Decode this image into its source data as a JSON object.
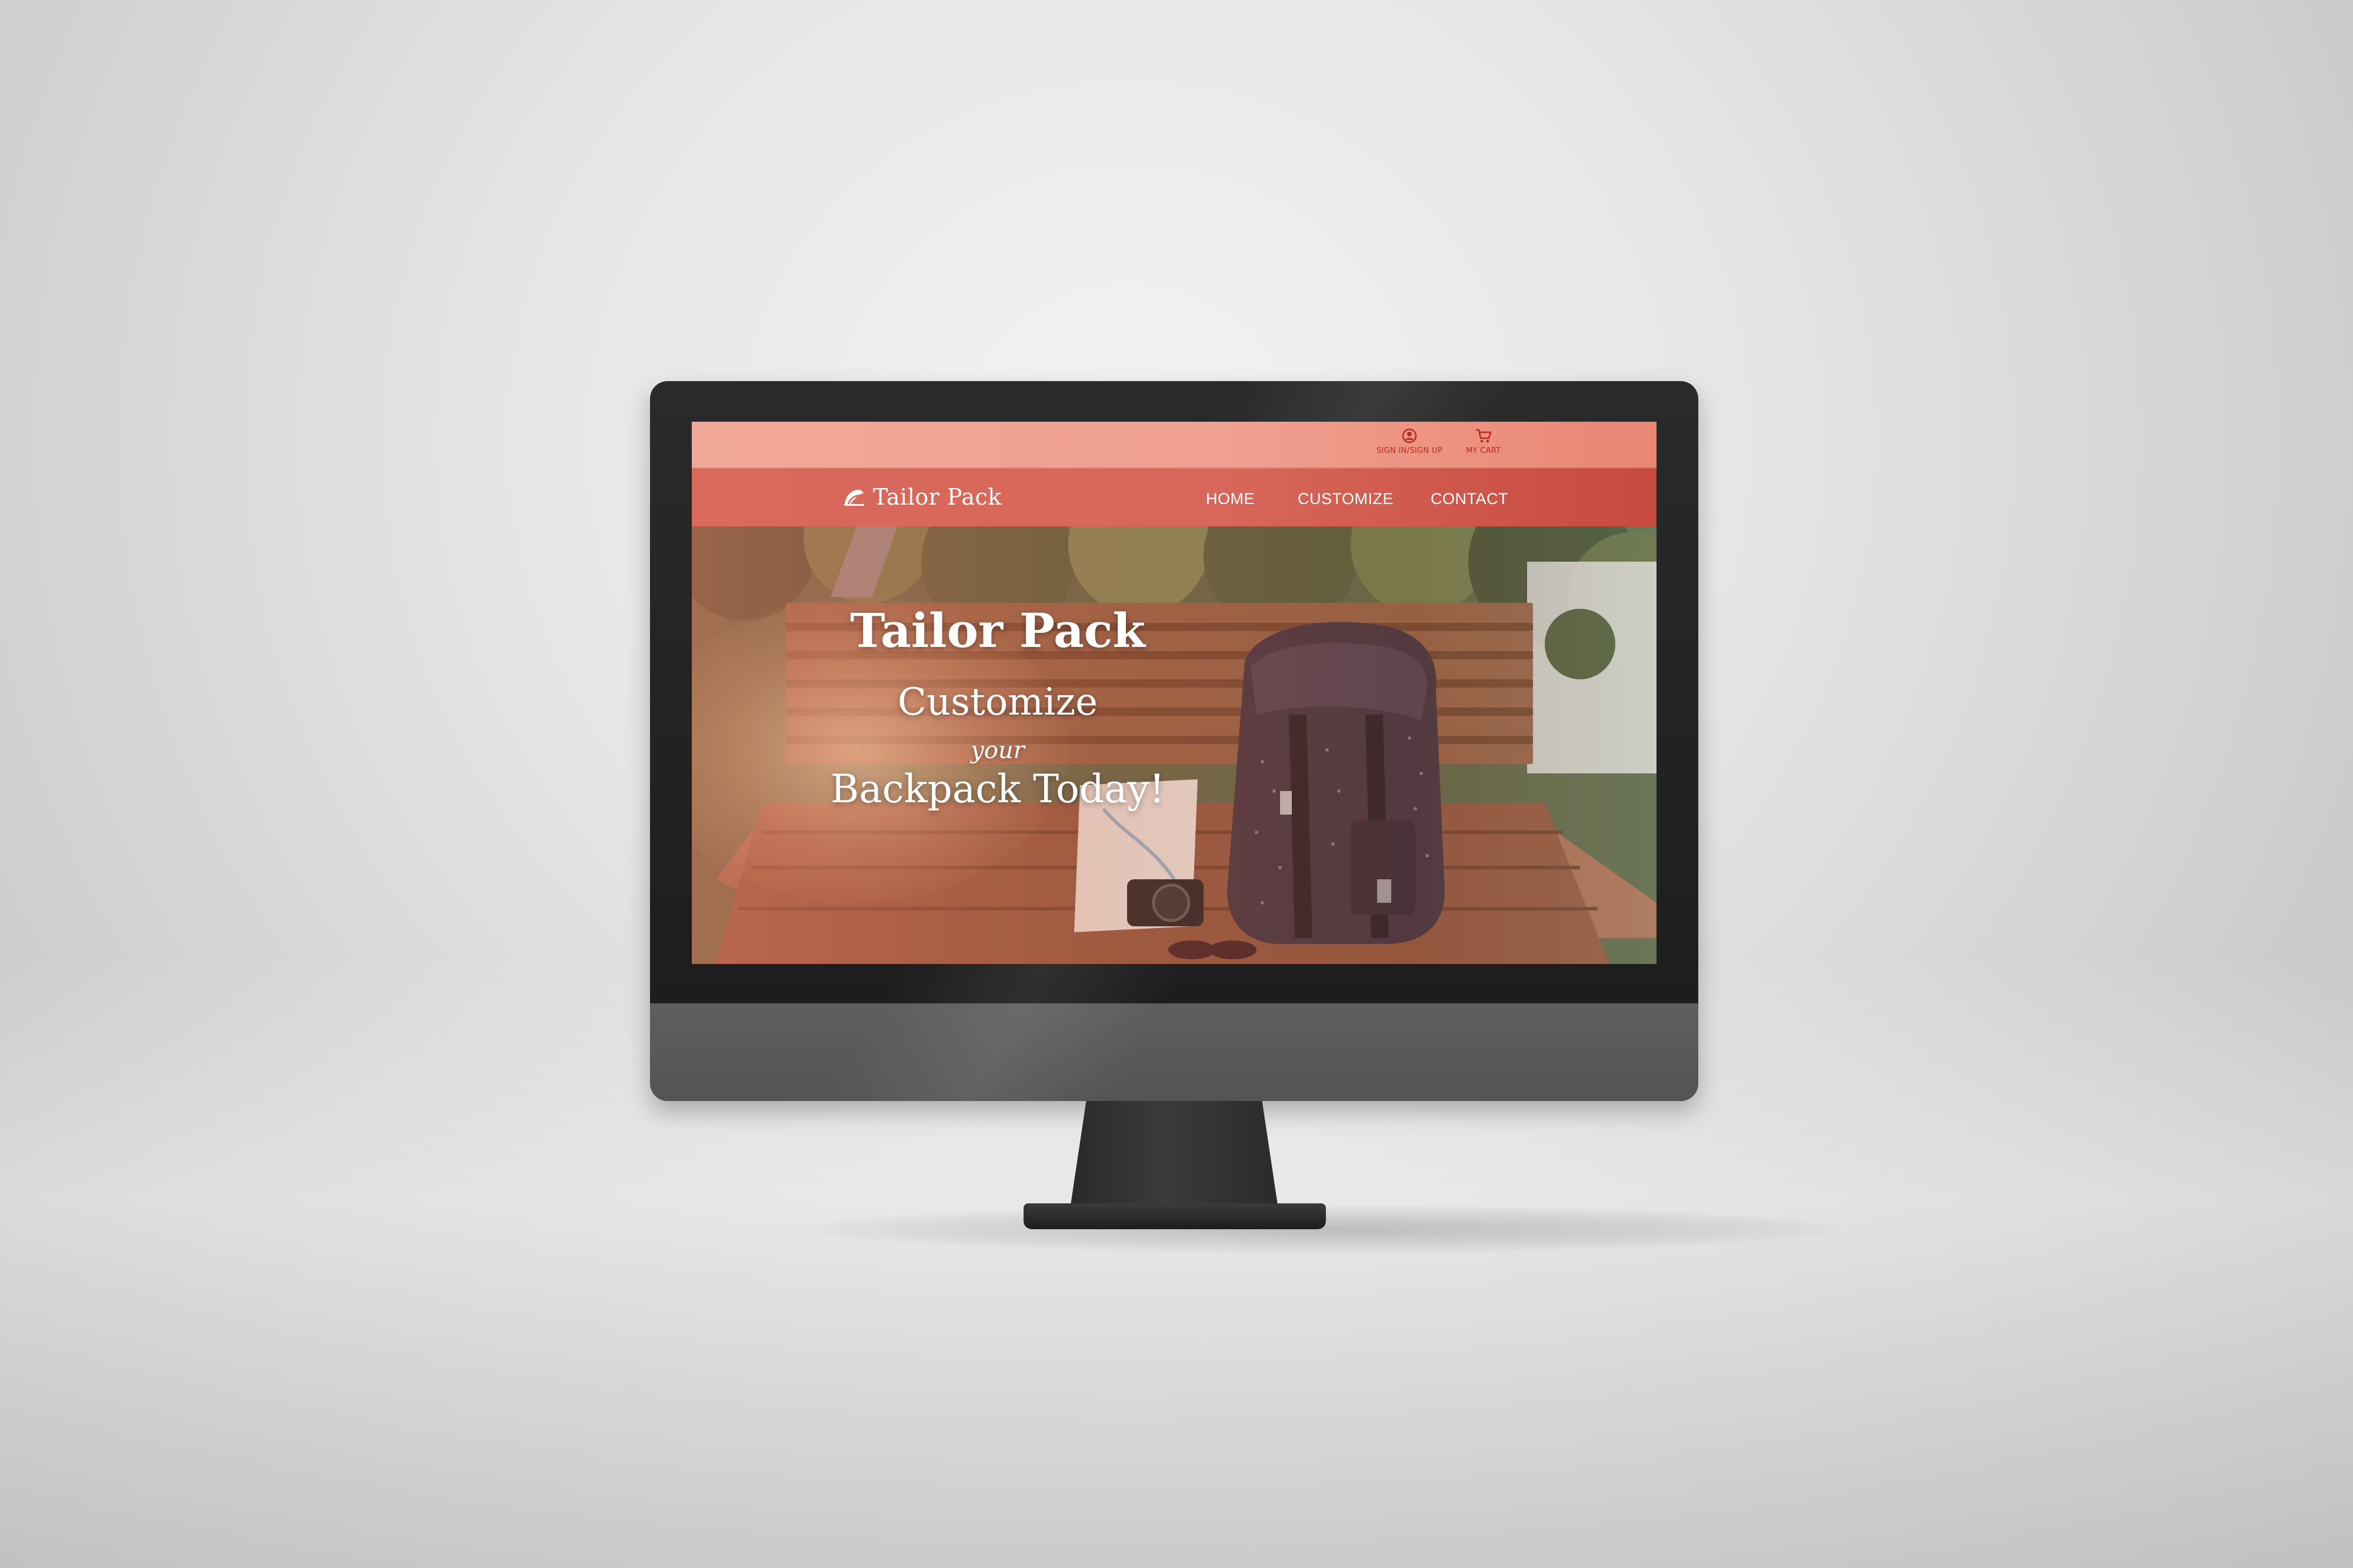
{
  "site": {
    "brand": "Tailor Pack",
    "colors": {
      "topbar": "#F0A090",
      "navbar": "#D7675A",
      "accent_text": "#B62C1F",
      "nav_text": "#FFFFFF"
    }
  },
  "topbar": {
    "links": [
      {
        "label": "SIGN IN/SIGN UP",
        "icon": "user-circle-icon"
      },
      {
        "label": "MY CART",
        "icon": "cart-icon"
      }
    ]
  },
  "navbar": {
    "logo_icon": "backpack-logo-icon",
    "items": [
      {
        "label": "HOME"
      },
      {
        "label": "CUSTOMIZE"
      },
      {
        "label": "CONTACT"
      }
    ]
  },
  "hero": {
    "title": "Tailor Pack",
    "line1": "Customize",
    "line2": "your",
    "line3": "Backpack Today!",
    "image_description": "backpack-on-wooden-bench"
  }
}
